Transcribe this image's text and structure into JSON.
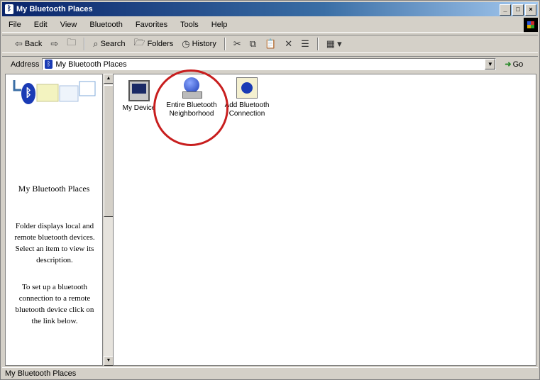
{
  "window": {
    "title": "My Bluetooth Places",
    "controls": {
      "minimize": "_",
      "maximize": "□",
      "close": "×"
    }
  },
  "menu": [
    "File",
    "Edit",
    "View",
    "Bluetooth",
    "Favorites",
    "Tools",
    "Help"
  ],
  "toolbar": {
    "back": "Back",
    "search": "Search",
    "folders": "Folders",
    "history": "History"
  },
  "address": {
    "label": "Address",
    "value": "My Bluetooth Places",
    "go": "Go"
  },
  "left_pane": {
    "title": "My Bluetooth Places",
    "description": "Folder displays local and remote bluetooth devices. Select an item to view its description.",
    "setup_text": "To set up a bluetooth connection to a remote bluetooth device click on the link below."
  },
  "items": [
    {
      "label": "My Device",
      "icon": "device-icon"
    },
    {
      "label": "Entire Bluetooth Neighborhood",
      "icon": "bluetooth-neighborhood-icon"
    },
    {
      "label": "Add Bluetooth Connection",
      "icon": "add-connection-icon"
    }
  ],
  "highlight_color": "#c81e1e",
  "status": "My Bluetooth Places"
}
